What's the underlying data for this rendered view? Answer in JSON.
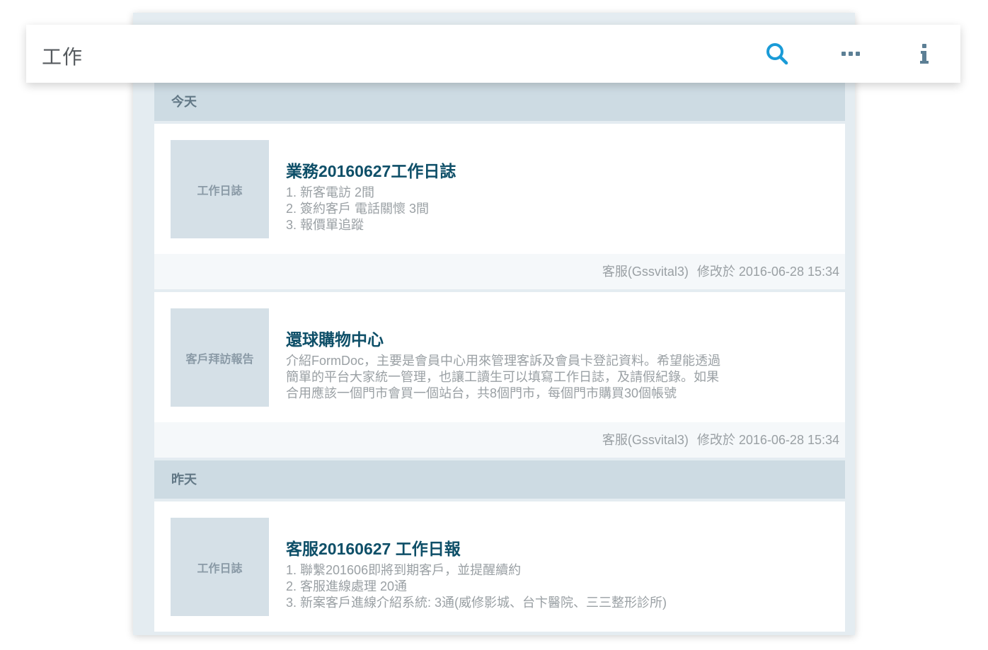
{
  "topbar": {
    "title": "工作",
    "icons": [
      "search-icon",
      "more-icon",
      "info-icon"
    ],
    "accent_color": "#1a9bd7",
    "icon_color": "#5c7f95"
  },
  "sections": [
    {
      "header": "今天",
      "items": [
        {
          "category": "工作日誌",
          "title": "業務20160627工作日誌",
          "lines": [
            "1. 新客電訪 2間",
            "2. 簽約客戶 電話關懷 3間",
            "3. 報價單追蹤"
          ],
          "author": "客服(Gssvital3)",
          "modified": "修改於 2016-06-28 15:34"
        },
        {
          "category": "客戶拜訪報告",
          "title": "還球購物中心",
          "lines": [
            "介紹FormDoc，主要是會員中心用來管理客訴及會員卡登記資料。希望能透過",
            "簡單的平台大家統一管理，也讓工讀生可以填寫工作日誌，及請假紀錄。如果",
            "合用應該一個門市會買一個站台，共8個門市，每個門市購買30個帳號"
          ],
          "author": "客服(Gssvital3)",
          "modified": "修改於 2016-06-28 15:34"
        }
      ]
    },
    {
      "header": "昨天",
      "items": [
        {
          "category": "工作日誌",
          "title": "客服20160627 工作日報",
          "lines": [
            "1. 聯繫201606即將到期客戶，並提醒續約",
            "2. 客服進線處理 20通",
            "3. 新案客戶進線介紹系統: 3通(威修影城、台卞醫院、三三整形診所)"
          ]
        }
      ]
    }
  ]
}
